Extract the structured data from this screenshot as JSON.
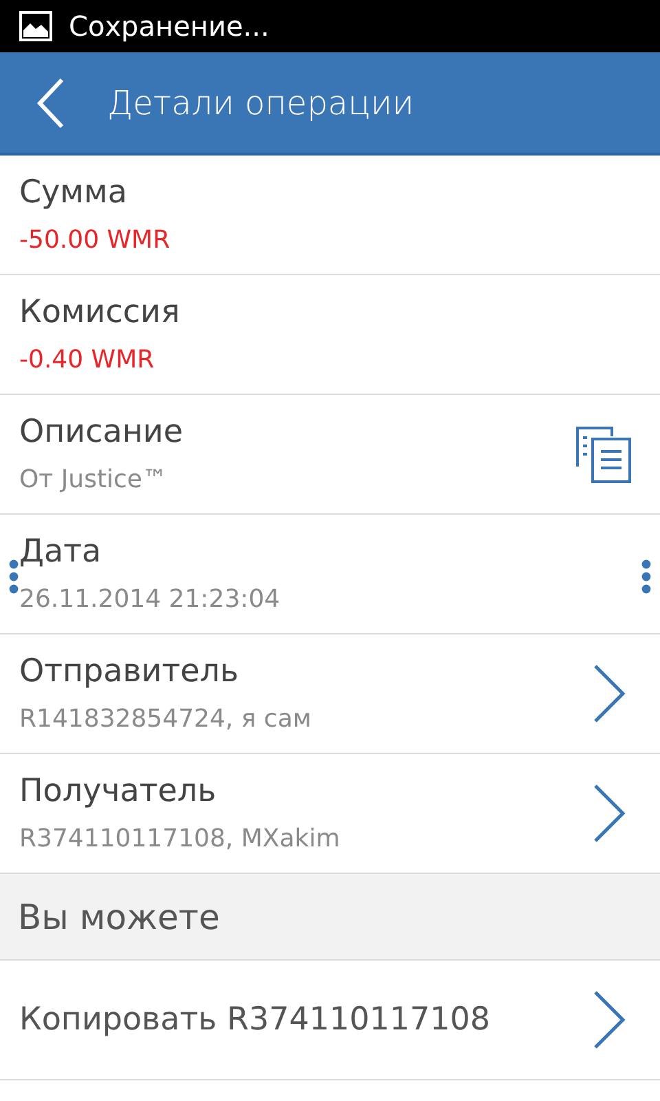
{
  "status_bar": {
    "notification": "Сохранение..."
  },
  "app_bar": {
    "title": "Детали операции"
  },
  "details": [
    {
      "kind": "amount",
      "label": "Сумма",
      "value": "-50.00 WMR"
    },
    {
      "kind": "amount",
      "label": "Комиссия",
      "value": "-0.40 WMR"
    },
    {
      "kind": "copy",
      "label": "Описание",
      "value": "От Justice™"
    },
    {
      "kind": "selectable",
      "label": "Дата",
      "value": "26.11.2014 21:23:04"
    },
    {
      "kind": "link",
      "label": "Отправитель",
      "value": "R141832854724, я сам"
    },
    {
      "kind": "link",
      "label": "Получатель",
      "value": "R374110117108, MXakim"
    }
  ],
  "section": {
    "title": "Вы можете"
  },
  "actions": [
    {
      "label": "Копировать R374110117108"
    }
  ]
}
